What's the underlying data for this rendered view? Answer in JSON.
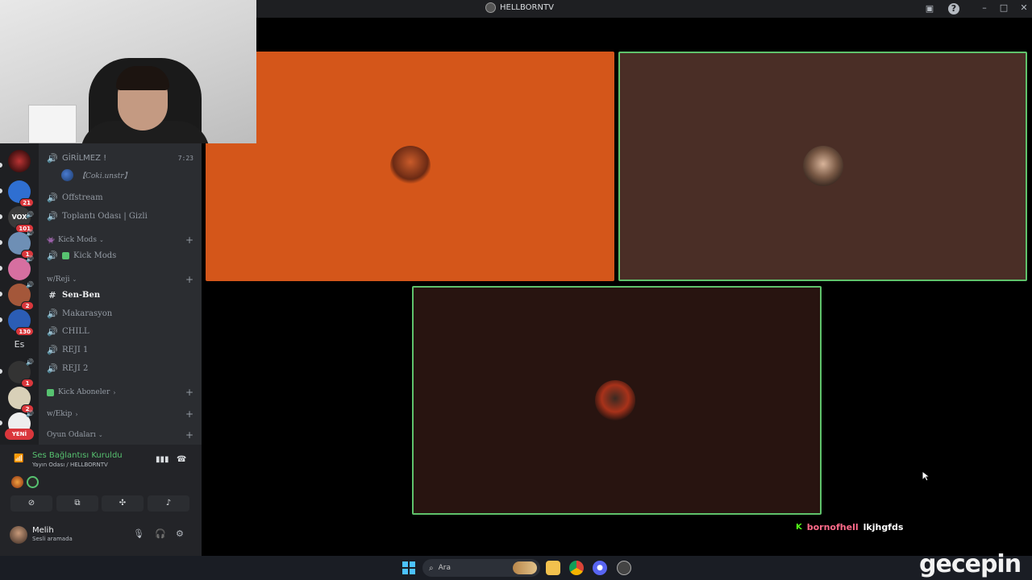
{
  "window": {
    "title": "HELLBORNTV"
  },
  "servers": [
    {
      "badge": "",
      "color": "#7a1f1f"
    },
    {
      "badge": "21",
      "color": "#2f6fd1"
    },
    {
      "badge": "101",
      "color": "#3a3a3a",
      "text": "VOX"
    },
    {
      "badge": "1",
      "color": "#6e8fb5"
    },
    {
      "badge": "",
      "color": "#d66fa0"
    },
    {
      "badge": "2",
      "color": "#a4573a"
    },
    {
      "badge": "130",
      "color": "#2b5db5"
    },
    {
      "text": "Es"
    },
    {
      "badge": "1",
      "color": "#333"
    },
    {
      "badge": "2",
      "color": "#d8d0b8"
    },
    {
      "badge": "",
      "color": "#eee"
    }
  ],
  "yeni_label": "YENİ",
  "channels": {
    "c1": {
      "name": "GİRİLMEZ !",
      "time": "7:23"
    },
    "member": "【Coki.unstr】",
    "c2": "Offstream",
    "c3": "Toplantı Odası | Gizli",
    "cat_kickmods": "Kick Mods",
    "c4": "Kick Mods",
    "cat_reji": "w/Reji",
    "c5": "Sen-Ben",
    "c6": "Makarasyon",
    "c7": "CHILL",
    "c8": "REJI 1",
    "c9": "REJI 2",
    "cat_aboneler": "Kick Aboneler",
    "cat_ekip": "w/Ekip",
    "cat_oyun": "Oyun Odaları"
  },
  "voice": {
    "status": "Ses Bağlantısı Kuruldu",
    "room": "Yayın Odası / HELLBORNTV"
  },
  "user": {
    "name": "Melih",
    "status": "Sesli aramada"
  },
  "chat": {
    "username": "bornofhell",
    "message": "lkjhgfds"
  },
  "taskbar": {
    "search_label": "Ara"
  },
  "watermark": "gecepin"
}
